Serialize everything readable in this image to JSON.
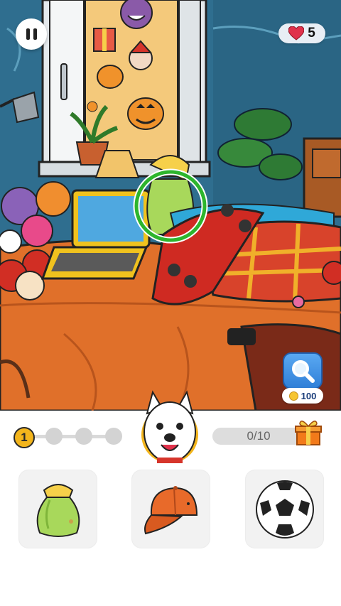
{
  "hud": {
    "pause_icon": "pause-icon",
    "lives": "5",
    "lives_icon": "heart-icon",
    "lives_color": "#e0314b"
  },
  "hint": {
    "icon": "magnifier-icon",
    "cost": "100",
    "currency_icon": "coin-icon"
  },
  "progress": {
    "level": "1",
    "stage_dots": 3,
    "found_text": "0/10",
    "found_fraction": 0.0,
    "reward_icon": "gift-icon"
  },
  "targets": [
    {
      "name": "green-sack",
      "icon": "sack-icon"
    },
    {
      "name": "orange-cap",
      "icon": "cap-icon"
    },
    {
      "name": "soccer-ball",
      "icon": "soccer-ball-icon"
    }
  ],
  "colors": {
    "highlight_ring": "#2db52d",
    "hint_button": "#3b8ee6",
    "level_badge": "#f3b51c"
  }
}
